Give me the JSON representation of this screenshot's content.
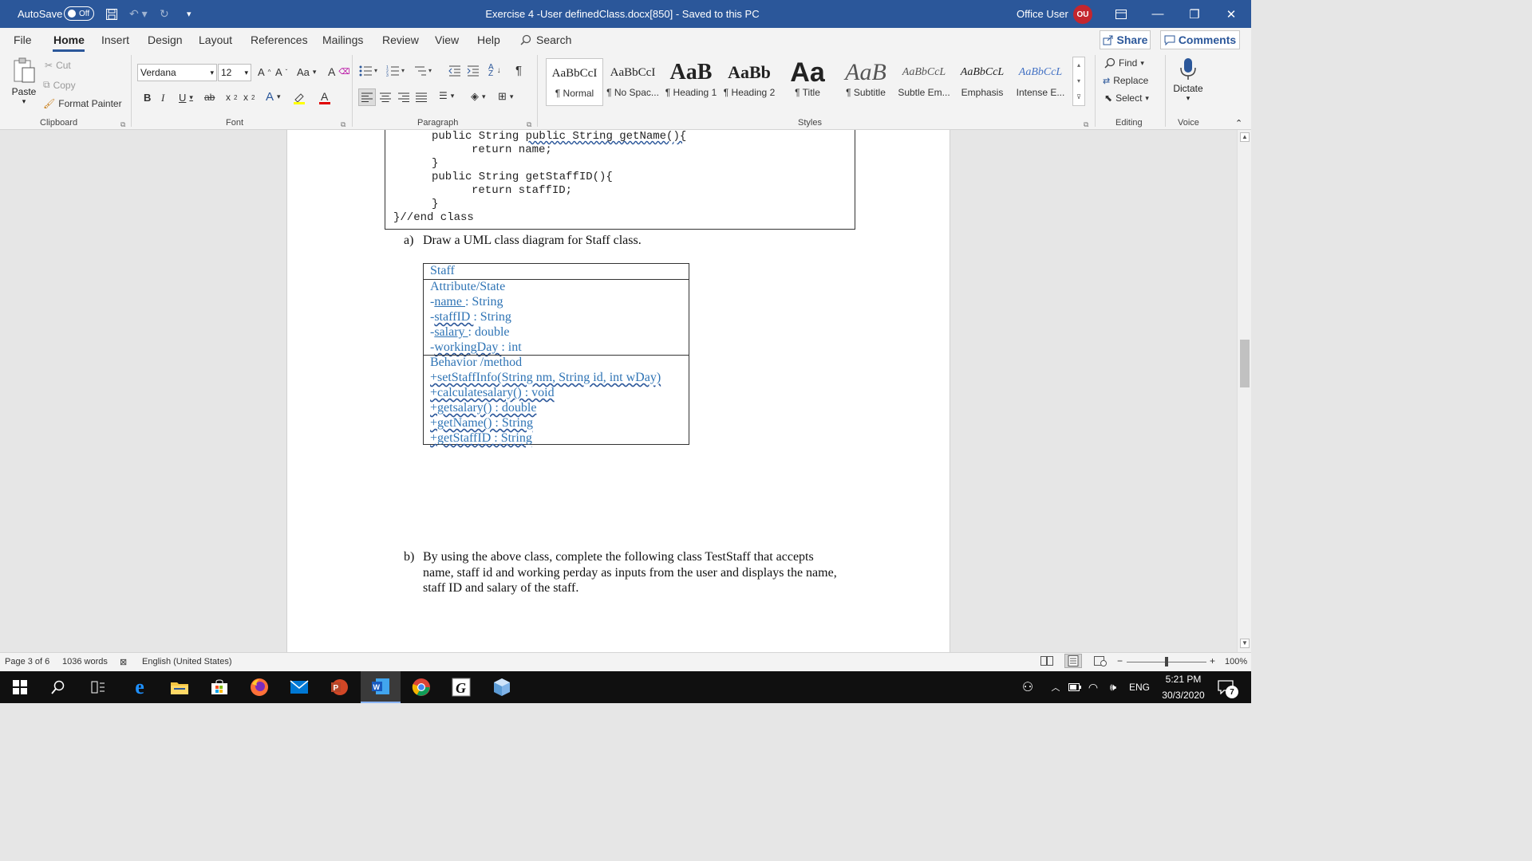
{
  "titlebar": {
    "autosave_label": "AutoSave",
    "autosave_state": "Off",
    "document_title": "Exercise 4 -User definedClass.docx[850]  -  Saved to this PC",
    "user_name": "Office User",
    "user_initials": "OU"
  },
  "tabs": [
    "File",
    "Home",
    "Insert",
    "Design",
    "Layout",
    "References",
    "Mailings",
    "Review",
    "View",
    "Help"
  ],
  "search_label": "Search",
  "share_label": "Share",
  "comments_label": "Comments",
  "ribbon": {
    "clipboard": {
      "paste": "Paste",
      "cut": "Cut",
      "copy": "Copy",
      "format_painter": "Format Painter",
      "label": "Clipboard"
    },
    "font": {
      "font_name": "Verdana",
      "font_size": "12",
      "case_label": "Aa",
      "label": "Font"
    },
    "paragraph": {
      "label": "Paragraph"
    },
    "styles": {
      "label": "Styles",
      "items": [
        {
          "sample": "AaBbCcI",
          "name": "¶ Normal"
        },
        {
          "sample": "AaBbCcI",
          "name": "¶ No Spac..."
        },
        {
          "sample": "AaB",
          "name": "¶ Heading 1"
        },
        {
          "sample": "AaBb",
          "name": "¶ Heading 2"
        },
        {
          "sample": "Aa",
          "name": "¶ Title"
        },
        {
          "sample": "AaB",
          "name": "¶ Subtitle"
        },
        {
          "sample": "AaBbCcL",
          "name": "Subtle Em..."
        },
        {
          "sample": "AaBbCcL",
          "name": "Emphasis"
        },
        {
          "sample": "AaBbCcL",
          "name": "Intense E..."
        }
      ]
    },
    "editing": {
      "find": "Find",
      "replace": "Replace",
      "select": "Select",
      "label": "Editing"
    },
    "voice": {
      "dictate": "Dictate",
      "label": "Voice"
    }
  },
  "document": {
    "code_lines": [
      "public String getName(){",
      "return name;",
      "}",
      "public String getStaffID(){",
      "return staffID;",
      "}",
      "}//end class"
    ],
    "question_a_marker": "a)",
    "question_a_text": "Draw a UML class diagram for Staff class.",
    "uml": {
      "class_name": "Staff",
      "attributes_header": "Attribute/State",
      "attributes": [
        {
          "prefix": "-",
          "name": "name ",
          "type": ": String"
        },
        {
          "prefix": "-",
          "name": "staffID ",
          "type": ": String"
        },
        {
          "prefix": "-",
          "name": "salary ",
          "type": ": double"
        },
        {
          "prefix": "-",
          "name": "workingDay ",
          "type": ": int"
        }
      ],
      "methods_header": "Behavior /method",
      "methods": [
        "+setStaffInfo(String nm, String id, int wDay)",
        "+calculatesalary() : void",
        "+getsalary() : double",
        "+getName() : String",
        "+getStaffID : String"
      ]
    },
    "question_b_marker": "b)",
    "question_b_lines": [
      "By using the above class, complete the following class TestStaff that accepts",
      "name, staff id and working perday as inputs from the user and displays the name,",
      "staff ID and salary of the staff."
    ]
  },
  "statusbar": {
    "page": "Page 3 of 6",
    "words": "1036 words",
    "language": "English (United States)",
    "zoom": "100%"
  },
  "taskbar": {
    "language": "ENG",
    "time": "5:21 PM",
    "date": "30/3/2020",
    "notifications": "7"
  }
}
